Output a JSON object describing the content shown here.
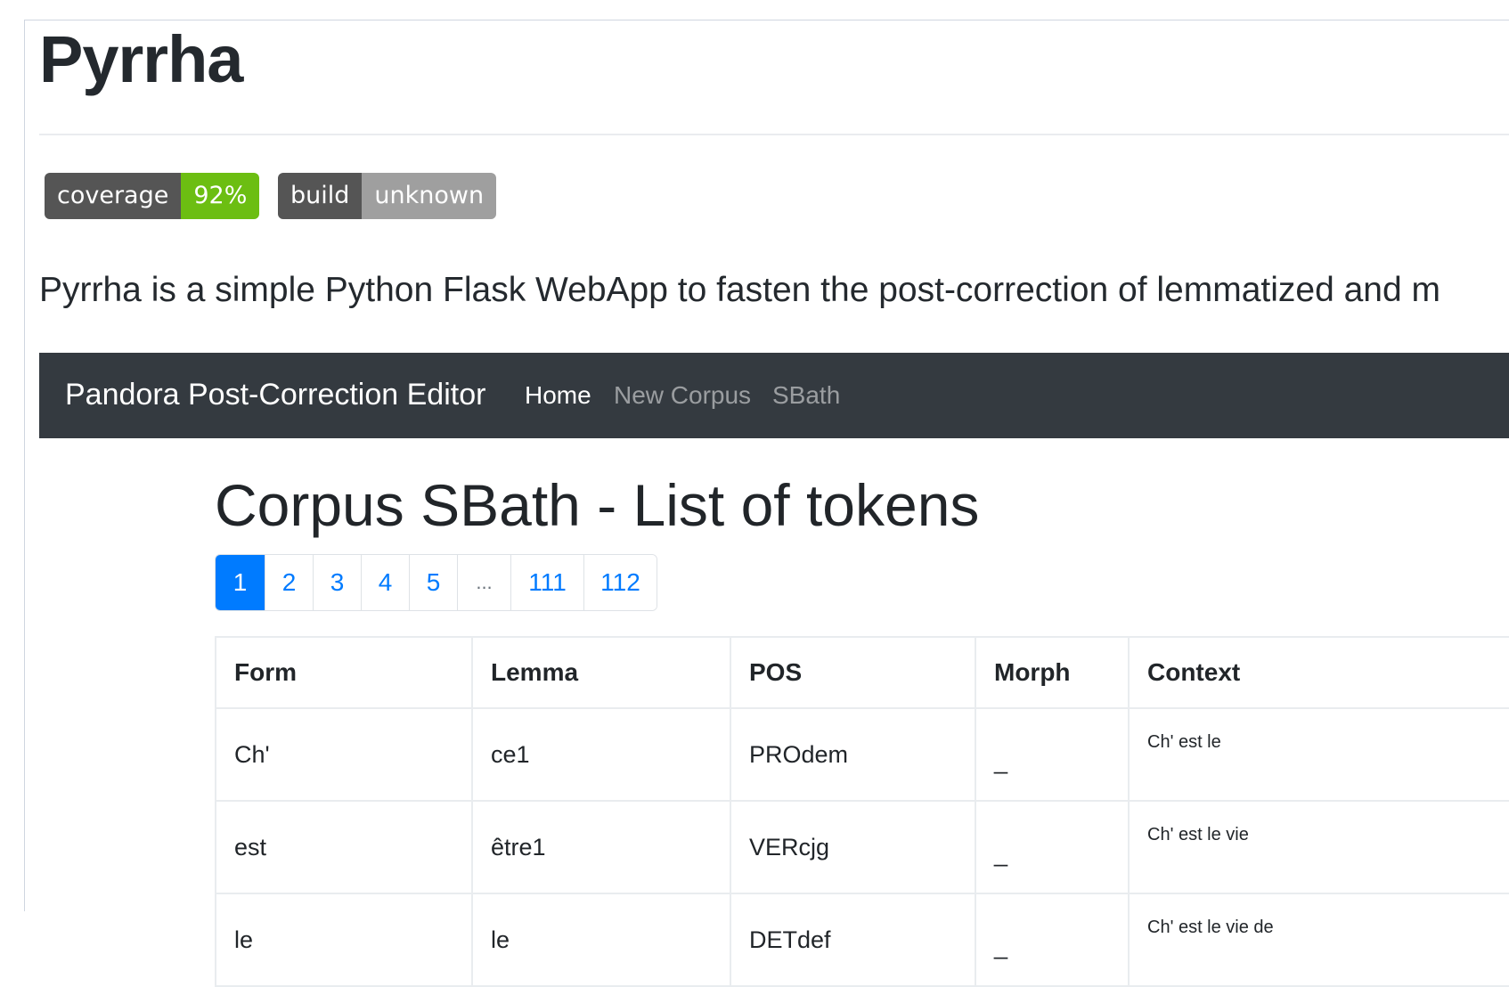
{
  "readme": {
    "title": "Pyrrha",
    "badges": [
      {
        "label": "coverage",
        "value": "92%",
        "color": "#6cbe12"
      },
      {
        "label": "build",
        "value": "unknown",
        "color": "#9f9f9f"
      }
    ],
    "description": "Pyrrha is a simple Python Flask WebApp to fasten the post-correction of lemmatized and m"
  },
  "app": {
    "navbar": {
      "brand": "Pandora Post-Correction Editor",
      "links": [
        "Home",
        "New Corpus",
        "SBath"
      ]
    },
    "title": "Corpus SBath - List of tokens",
    "pagination": [
      "1",
      "2",
      "3",
      "4",
      "5",
      "...",
      "111",
      "112"
    ],
    "table": {
      "headers": [
        "Form",
        "Lemma",
        "POS",
        "Morph",
        "Context"
      ],
      "rows": [
        [
          "Ch'",
          "ce1",
          "PROdem",
          "_",
          "Ch' est le"
        ],
        [
          "est",
          "être1",
          "VERcjg",
          "_",
          "Ch' est le vie"
        ],
        [
          "le",
          "le",
          "DETdef",
          "_",
          "Ch' est le vie de"
        ]
      ]
    }
  },
  "colors": {
    "navbar": "#343a40",
    "primary": "#007bff",
    "badge_label": "#555555"
  }
}
